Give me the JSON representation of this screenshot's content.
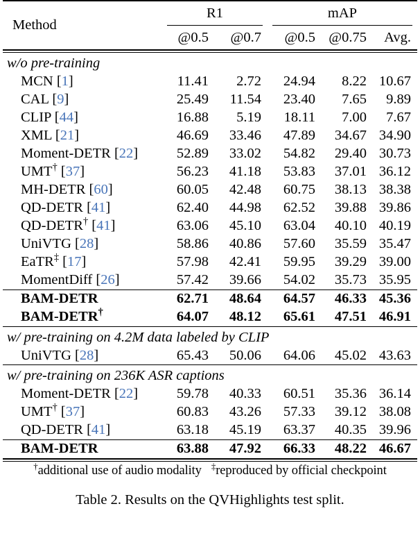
{
  "table": {
    "columns": {
      "method_header": "Method",
      "groups": [
        {
          "label": "R1",
          "span": 2
        },
        {
          "label": "mAP",
          "span": 3
        }
      ],
      "subheaders": [
        "@0.5",
        "@0.7",
        "@0.5",
        "@0.75",
        "Avg."
      ]
    },
    "sections": [
      {
        "label": "w/o pre-training",
        "rows": [
          {
            "method": "MCN",
            "dagger": "",
            "cite": "1",
            "bold": false,
            "values": [
              "11.41",
              "2.72",
              "24.94",
              "8.22",
              "10.67"
            ]
          },
          {
            "method": "CAL",
            "dagger": "",
            "cite": "9",
            "bold": false,
            "values": [
              "25.49",
              "11.54",
              "23.40",
              "7.65",
              "9.89"
            ]
          },
          {
            "method": "CLIP",
            "dagger": "",
            "cite": "44",
            "bold": false,
            "values": [
              "16.88",
              "5.19",
              "18.11",
              "7.00",
              "7.67"
            ]
          },
          {
            "method": "XML",
            "dagger": "",
            "cite": "21",
            "bold": false,
            "values": [
              "46.69",
              "33.46",
              "47.89",
              "34.67",
              "34.90"
            ]
          },
          {
            "method": "Moment-DETR",
            "dagger": "",
            "cite": "22",
            "bold": false,
            "values": [
              "52.89",
              "33.02",
              "54.82",
              "29.40",
              "30.73"
            ]
          },
          {
            "method": "UMT",
            "dagger": "†",
            "cite": "37",
            "bold": false,
            "values": [
              "56.23",
              "41.18",
              "53.83",
              "37.01",
              "36.12"
            ]
          },
          {
            "method": "MH-DETR",
            "dagger": "",
            "cite": "60",
            "bold": false,
            "values": [
              "60.05",
              "42.48",
              "60.75",
              "38.13",
              "38.38"
            ]
          },
          {
            "method": "QD-DETR",
            "dagger": "",
            "cite": "41",
            "bold": false,
            "values": [
              "62.40",
              "44.98",
              "62.52",
              "39.88",
              "39.86"
            ]
          },
          {
            "method": "QD-DETR",
            "dagger": "†",
            "cite": "41",
            "bold": false,
            "values": [
              "63.06",
              "45.10",
              "63.04",
              "40.10",
              "40.19"
            ]
          },
          {
            "method": "UniVTG",
            "dagger": "",
            "cite": "28",
            "bold": false,
            "values": [
              "58.86",
              "40.86",
              "57.60",
              "35.59",
              "35.47"
            ]
          },
          {
            "method": "EaTR",
            "dagger": "‡",
            "cite": "17",
            "bold": false,
            "values": [
              "57.98",
              "42.41",
              "59.95",
              "39.29",
              "39.00"
            ]
          },
          {
            "method": "MomentDiff",
            "dagger": "",
            "cite": "26",
            "bold": false,
            "values": [
              "57.42",
              "39.66",
              "54.02",
              "35.73",
              "35.95"
            ]
          }
        ]
      },
      {
        "label": "",
        "rule_before": true,
        "rows": [
          {
            "method": "BAM-DETR",
            "dagger": "",
            "cite": "",
            "bold": true,
            "values": [
              "62.71",
              "48.64",
              "64.57",
              "46.33",
              "45.36"
            ]
          },
          {
            "method": "BAM-DETR",
            "dagger": "†",
            "cite": "",
            "bold": true,
            "values": [
              "64.07",
              "48.12",
              "65.61",
              "47.51",
              "46.91"
            ]
          }
        ]
      },
      {
        "label": "w/ pre-training on 4.2M data labeled by CLIP",
        "rule_before": true,
        "rows": [
          {
            "method": "UniVTG",
            "dagger": "",
            "cite": "28",
            "bold": false,
            "values": [
              "65.43",
              "50.06",
              "64.06",
              "45.02",
              "43.63"
            ]
          }
        ]
      },
      {
        "label": "w/ pre-training on 236K ASR captions",
        "rule_before": true,
        "rows": [
          {
            "method": "Moment-DETR",
            "dagger": "",
            "cite": "22",
            "bold": false,
            "values": [
              "59.78",
              "40.33",
              "60.51",
              "35.36",
              "36.14"
            ]
          },
          {
            "method": "UMT",
            "dagger": "†",
            "cite": "37",
            "bold": false,
            "values": [
              "60.83",
              "43.26",
              "57.33",
              "39.12",
              "38.08"
            ]
          },
          {
            "method": "QD-DETR",
            "dagger": "",
            "cite": "41",
            "bold": false,
            "values": [
              "63.18",
              "45.19",
              "63.37",
              "40.35",
              "39.96"
            ]
          }
        ]
      },
      {
        "label": "",
        "rule_before": true,
        "rows": [
          {
            "method": "BAM-DETR",
            "dagger": "",
            "cite": "",
            "bold": true,
            "values": [
              "63.88",
              "47.92",
              "66.33",
              "48.22",
              "46.67"
            ]
          }
        ]
      }
    ]
  },
  "footnotes": {
    "first_marker": "†",
    "first_text": "additional use of audio modality",
    "second_marker": "‡",
    "second_text": "reproduced by official checkpoint"
  },
  "caption": "Table 2. Results on the QVHighlights test split.",
  "colors": {
    "citation_link": "#4874b8",
    "text": "#000000",
    "background": "#ffffff"
  }
}
